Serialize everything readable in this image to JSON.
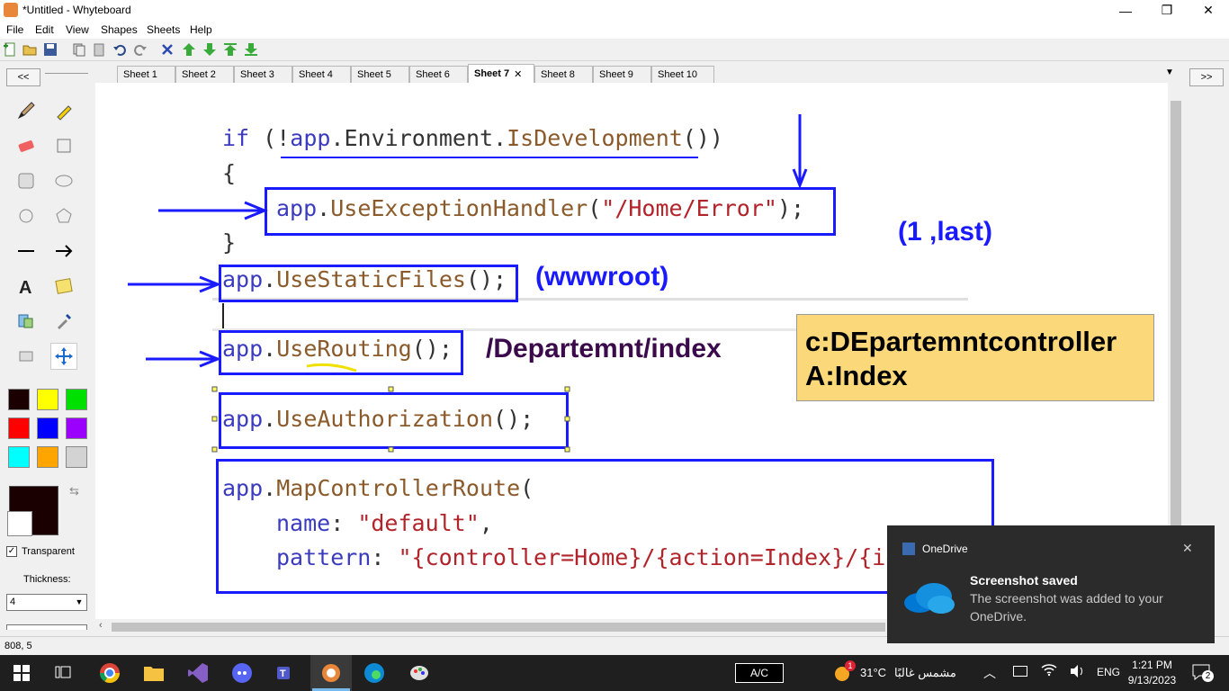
{
  "window": {
    "title": "*Untitled - Whyteboard",
    "minimize": "—",
    "restore": "❐",
    "close": "✕"
  },
  "menu": [
    "File",
    "Edit",
    "View",
    "Shapes",
    "Sheets",
    "Help"
  ],
  "toolbar_icons": [
    "new-icon",
    "open-icon",
    "save-icon",
    "copy-icon",
    "paste-icon",
    "undo-icon",
    "redo-icon",
    "delete-icon",
    "move-up-icon",
    "move-down-icon",
    "move-top-icon",
    "move-bottom-icon"
  ],
  "left_panel": {
    "collapse_label": "<<",
    "transparent_label": "Transparent",
    "transparent_checked": true,
    "thickness_label": "Thickness:",
    "thickness_value": "4"
  },
  "right_panel": {
    "expand_label": ">>"
  },
  "colors": [
    "#1a0000",
    "#ffff00",
    "#00e000",
    "#ff0000",
    "#0000ff",
    "#9b00ff",
    "#00ffff",
    "#ffa500",
    "#d3d3d3"
  ],
  "tabs": [
    "Sheet 1",
    "Sheet 2",
    "Sheet 3",
    "Sheet 4",
    "Sheet 5",
    "Sheet 6",
    "Sheet 7",
    "Sheet 8",
    "Sheet 9",
    "Sheet 10"
  ],
  "active_tab": "Sheet 7",
  "code": {
    "line1_if": "if",
    "line1_open": " (!",
    "line1_app": "app",
    "line1_dot": ".",
    "line1_env": "Environment",
    "line1_dot2": ".",
    "line1_isdev": "IsDevelopment",
    "line1_close": "())",
    "brace_open": "{",
    "handler_app": "app",
    "handler_method": "UseExceptionHandler",
    "handler_open": "(",
    "handler_str": "\"/Home/Error\"",
    "handler_close": ");",
    "brace_close": "}",
    "static_app": "app",
    "static_method": "UseStaticFiles",
    "static_end": "();",
    "routing_app": "app",
    "routing_method": "UseRouting",
    "routing_end": "();",
    "auth_app": "app",
    "auth_method": "UseAuthorization",
    "auth_end": "();",
    "map_app": "app",
    "map_method": "MapControllerRoute",
    "map_open": "(",
    "name_key": "name",
    "name_colon": ": ",
    "name_val": "\"default\"",
    "name_comma": ",",
    "pattern_key": "pattern",
    "pattern_colon": ": ",
    "pattern_val": "\"{controller=Home}/{action=Index}/{id"
  },
  "annotations": {
    "first_last": "(1 ,last)",
    "wwwroot": "(wwwroot)",
    "url": "/Departemnt/index",
    "note_line1": "c:DEpartemntcontroller",
    "note_line2": "A:Index"
  },
  "status": {
    "coords": "808, 5"
  },
  "taskbar": {
    "ac_label": "A/C",
    "weather_temp": "31°C",
    "weather_text": "مشمس غالبًا",
    "lang": "ENG",
    "time": "1:21 PM",
    "date": "9/13/2023",
    "notif_count": "2",
    "weather_badge": "1"
  },
  "toast": {
    "app": "OneDrive",
    "title": "Screenshot saved",
    "body_line1": "The screenshot was added to your",
    "body_line2": "OneDrive."
  }
}
